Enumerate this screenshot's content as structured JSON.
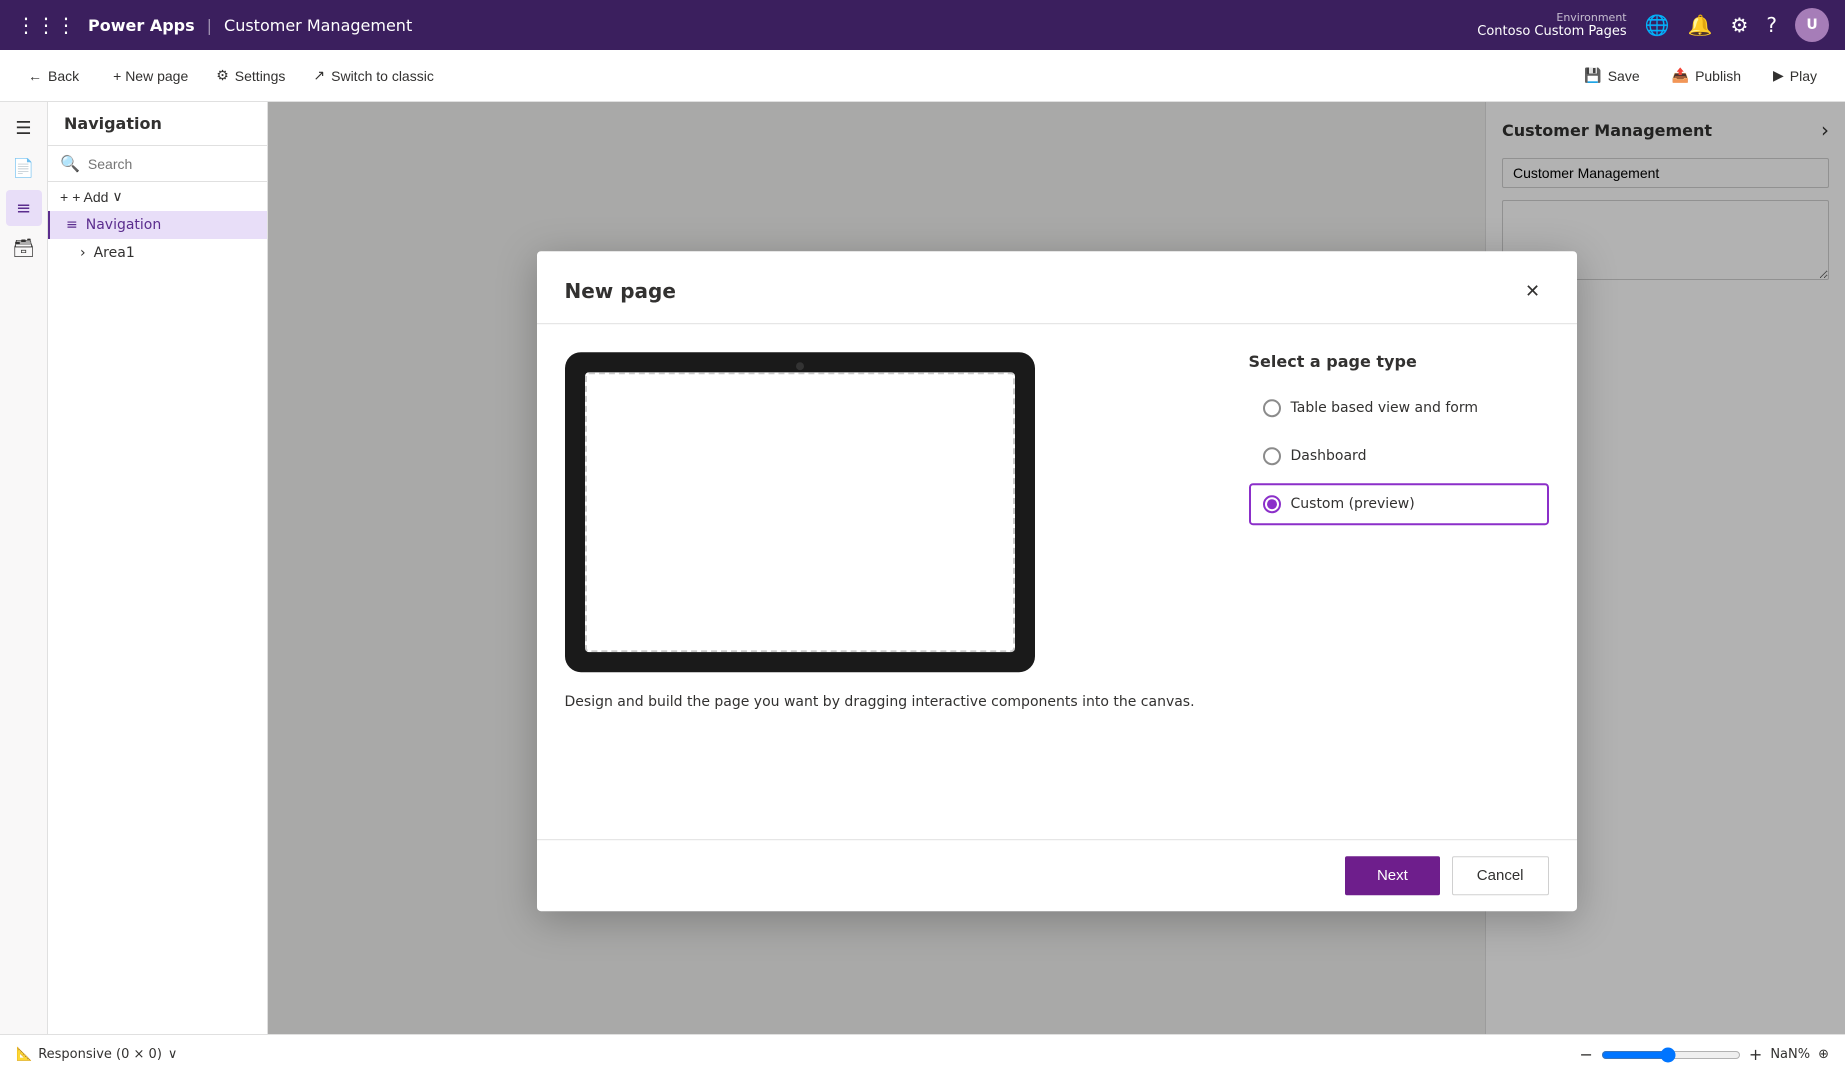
{
  "topnav": {
    "app_name": "Power Apps",
    "separator": "|",
    "project_name": "Customer Management",
    "environment_label": "Environment",
    "environment_name": "Contoso Custom Pages"
  },
  "toolbar": {
    "back_label": "Back",
    "new_page_label": "+ New page",
    "settings_label": "Settings",
    "switch_label": "Switch to classic",
    "save_label": "Save",
    "publish_label": "Publish",
    "play_label": "Play"
  },
  "left_panel": {
    "title": "Navigation",
    "search_placeholder": "Search",
    "add_label": "+ Add",
    "items": [
      {
        "label": "Navigation",
        "icon": "≡",
        "indent": false
      },
      {
        "label": "Area1",
        "icon": "›",
        "indent": true
      }
    ]
  },
  "right_panel": {
    "title": "Customer Management",
    "chevron_label": "›",
    "input_value": "Customer Management",
    "textarea_value": ""
  },
  "modal": {
    "title": "New page",
    "close_icon": "✕",
    "page_type_label": "Select a page type",
    "page_types": [
      {
        "id": "table",
        "label": "Table based view and form",
        "selected": false
      },
      {
        "id": "dashboard",
        "label": "Dashboard",
        "selected": false
      },
      {
        "id": "custom",
        "label": "Custom (preview)",
        "selected": true
      }
    ],
    "description": "Design and build the page you want by dragging interactive components into the canvas.",
    "next_label": "Next",
    "cancel_label": "Cancel"
  },
  "statusbar": {
    "responsive_label": "Responsive (0 × 0)",
    "chevron": "∨",
    "zoom_label": "NaN%",
    "plus_label": "+",
    "target_icon": "⊕"
  }
}
